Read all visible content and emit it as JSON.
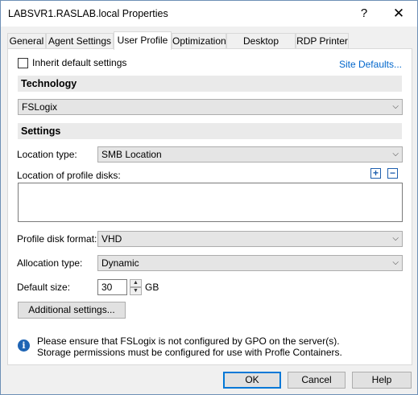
{
  "window": {
    "title": "LABSVR1.RASLAB.local Properties",
    "help_glyph": "?",
    "close_glyph": "✕"
  },
  "tabs": [
    {
      "label": "General",
      "active": false
    },
    {
      "label": "Agent Settings",
      "active": false
    },
    {
      "label": "User Profile",
      "active": true
    },
    {
      "label": "Optimization",
      "active": false
    },
    {
      "label": "Desktop Access",
      "active": false
    },
    {
      "label": "RDP Printer",
      "active": false
    }
  ],
  "profile": {
    "inherit_label": "Inherit default settings",
    "inherit_checked": false,
    "site_defaults_link": "Site Defaults...",
    "technology_header": "Technology",
    "technology_value": "FSLogix",
    "settings_header": "Settings",
    "location_type_label": "Location type:",
    "location_type_value": "SMB Location",
    "location_disks_label": "Location of profile disks:",
    "add_glyph": "+",
    "remove_glyph": "−",
    "disk_format_label": "Profile disk format:",
    "disk_format_value": "VHD",
    "allocation_label": "Allocation type:",
    "allocation_value": "Dynamic",
    "default_size_label": "Default size:",
    "default_size_value": "30",
    "default_size_unit": "GB",
    "additional_button": "Additional settings...",
    "info_line1": "Please ensure that FSLogix is not configured by GPO on the server(s).",
    "info_line2": "Storage permissions must be configured for use with Profle Containers."
  },
  "footer": {
    "ok": "OK",
    "cancel": "Cancel",
    "help": "Help"
  },
  "icons": {
    "dropdown": "chevron-down-icon",
    "info": "info-icon"
  },
  "colors": {
    "link": "#0066cc",
    "accent": "#0078d7",
    "info": "#1e64b4"
  }
}
